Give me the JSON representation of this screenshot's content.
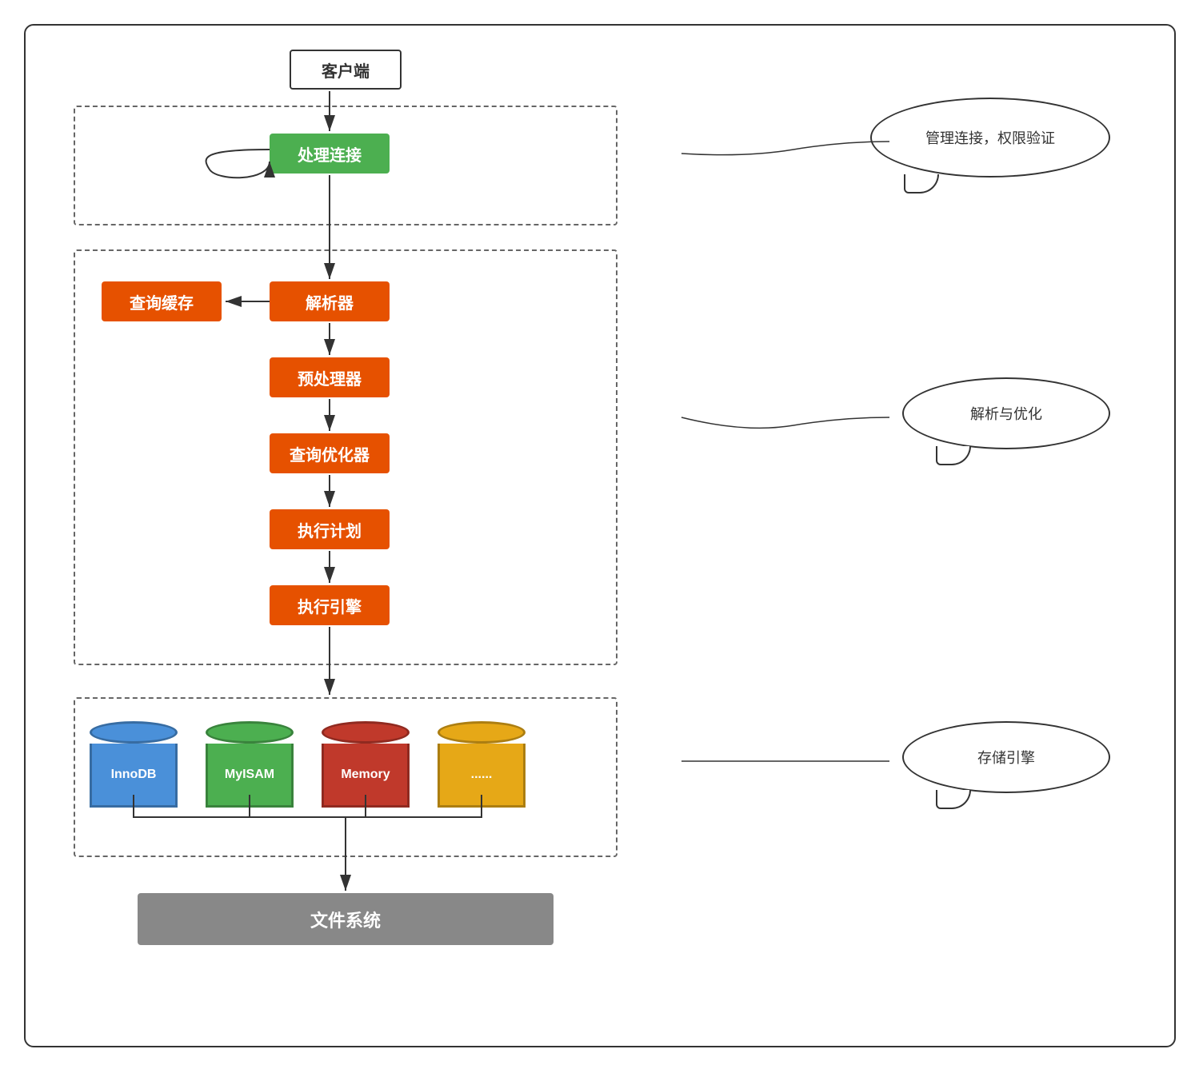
{
  "diagram": {
    "nodes": {
      "client": "客户端",
      "connection": "处理连接",
      "query_cache": "查询缓存",
      "parser": "解析器",
      "preprocessor": "预处理器",
      "optimizer": "查询优化器",
      "exec_plan": "执行计划",
      "exec_engine": "执行引擎",
      "filesystem": "文件系统"
    },
    "bubbles": {
      "admin": "管理连接，权限验证",
      "parse": "解析与优化",
      "storage": "存储引擎"
    },
    "engines": {
      "innodb": "InnoDB",
      "myisam": "MyISAM",
      "memory": "Memory",
      "other": "......"
    }
  }
}
